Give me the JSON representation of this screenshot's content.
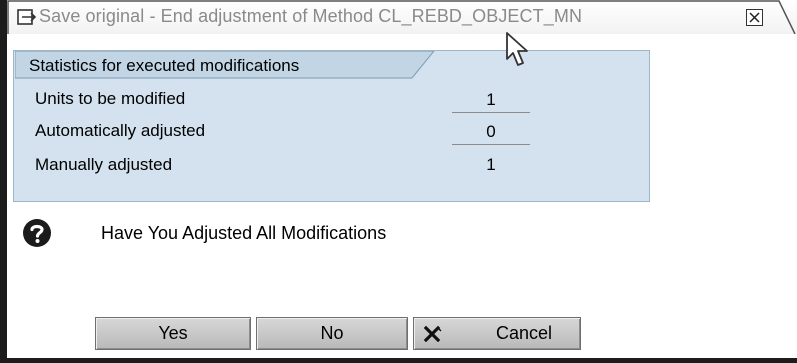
{
  "window": {
    "title": "Save original - End adjustment of Method CL_REBD_OBJECT_MN",
    "close_icon": "close-icon"
  },
  "statistics": {
    "header": "Statistics for executed modifications",
    "rows": [
      {
        "label": "Units to be modified",
        "value": "1"
      },
      {
        "label": "Automatically adjusted",
        "value": "0"
      },
      {
        "label": "Manually adjusted",
        "value": "1"
      }
    ]
  },
  "message": {
    "icon": "question-icon",
    "text": "Have You Adjusted All Modifications"
  },
  "buttons": {
    "yes": "Yes",
    "no": "No",
    "cancel": "Cancel",
    "cancel_icon": "cancel-x-icon"
  },
  "colors": {
    "group_background": "#d3e2ee",
    "button_background": "#c6c6c6",
    "title_text": "#8a8a8a"
  }
}
